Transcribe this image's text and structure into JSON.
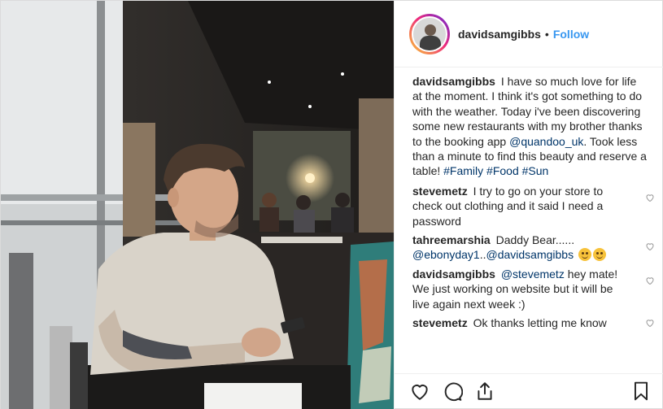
{
  "post": {
    "username": "davidsamgibbs",
    "separator": "•",
    "follow_label": "Follow",
    "caption": {
      "username": "davidsamgibbs",
      "text_1": "I have so much love for life at the moment. I think it's got something to do with the weather. Today i've been discovering some new restaurants with my brother thanks to the booking app",
      "mention": "@quandoo_uk",
      "text_2": ". Took less than a minute to find this beauty and reserve a table!",
      "hashtag_1": "#Family",
      "hashtag_2": "#Food",
      "hashtag_3": "#Sun"
    },
    "comments": [
      {
        "username": "stevemetz",
        "text": "I try to go on your store to check out clothing and it said I need a password"
      },
      {
        "username": "tahreemarshia",
        "text": "Daddy Bear......",
        "mention_1": "@ebonyday1",
        "text_2": "..",
        "mention_2": "@davidsamgibbs"
      },
      {
        "username": "davidsamgibbs",
        "mention": "@stevemetz",
        "text": "hey mate! We just working on website but it will be live again next week :)"
      },
      {
        "username": "stevemetz",
        "text": "Ok thanks letting me know"
      }
    ]
  },
  "icons": {
    "like": "heart-outline-icon",
    "comment": "speech-bubble-icon",
    "share": "share-upload-icon",
    "save": "bookmark-icon",
    "comment_like": "small-heart-icon",
    "emoji": "smiling-face-emoji"
  },
  "colors": {
    "link": "#003569",
    "follow": "#3897f0",
    "text": "#262626",
    "border": "#efefef"
  }
}
